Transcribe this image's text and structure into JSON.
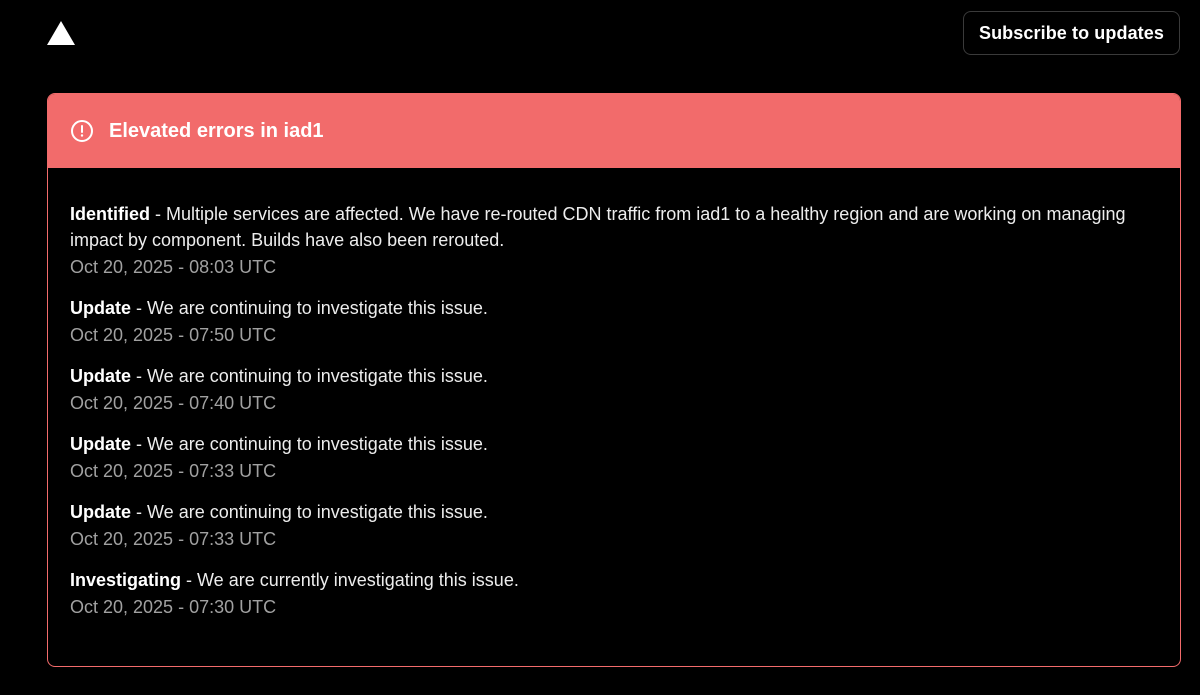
{
  "header": {
    "logo_icon": "triangle-logo-icon",
    "subscribe_label": "Subscribe to updates"
  },
  "incident": {
    "title": "Elevated errors in iad1",
    "alert_icon": "alert-circle-icon",
    "accent_color": "#f26b6b",
    "separator": " - ",
    "updates": [
      {
        "status": "Identified",
        "message": "Multiple services are affected. We have re-routed CDN traffic from iad1 to a healthy region and are working on managing impact by component. Builds have also been rerouted.",
        "time": "Oct 20, 2025 - 08:03 UTC"
      },
      {
        "status": "Update",
        "message": "We are continuing to investigate this issue.",
        "time": "Oct 20, 2025 - 07:50 UTC"
      },
      {
        "status": "Update",
        "message": "We are continuing to investigate this issue.",
        "time": "Oct 20, 2025 - 07:40 UTC"
      },
      {
        "status": "Update",
        "message": "We are continuing to investigate this issue.",
        "time": "Oct 20, 2025 - 07:33 UTC"
      },
      {
        "status": "Update",
        "message": "We are continuing to investigate this issue.",
        "time": "Oct 20, 2025 - 07:33 UTC"
      },
      {
        "status": "Investigating",
        "message": "We are currently investigating this issue.",
        "time": "Oct 20, 2025 - 07:30 UTC"
      }
    ]
  }
}
